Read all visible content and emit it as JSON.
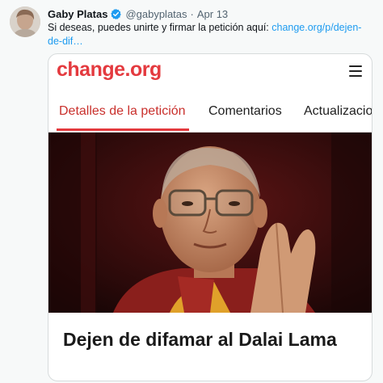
{
  "tweet": {
    "author_name": "Gaby Platas",
    "handle": "@gabyplatas",
    "separator": "·",
    "date": "Apr 13",
    "text": "Si deseas, puedes unirte y firmar la petición aquí:",
    "link": "change.org/p/dejen-de-dif…"
  },
  "card": {
    "logo": "change.org",
    "tabs": [
      {
        "label": "Detalles de la petición",
        "active": true
      },
      {
        "label": "Comentarios",
        "active": false
      },
      {
        "label": "Actualizacio",
        "active": false
      }
    ],
    "petition_title": "Dejen de difamar al Dalai Lama"
  },
  "colors": {
    "link": "#1d9bf0",
    "verified": "#1d9bf0",
    "brand": "#e43a3f",
    "active_tab": "#c9302c"
  },
  "icons": {
    "verified": "verified-badge-icon",
    "menu": "hamburger-menu-icon"
  }
}
